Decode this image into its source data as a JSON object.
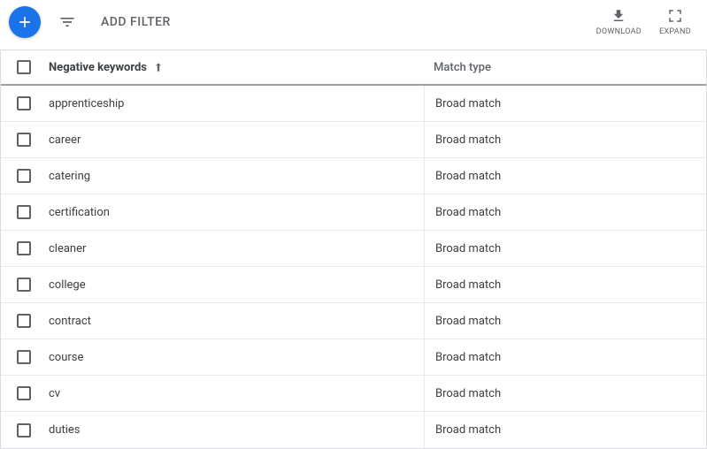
{
  "toolbar": {
    "add_filter_label": "ADD FILTER",
    "download_label": "DOWNLOAD",
    "expand_label": "EXPAND"
  },
  "table": {
    "header": {
      "keyword_col": "Negative keywords",
      "match_col": "Match type"
    },
    "rows": [
      {
        "keyword": "apprenticeship",
        "match": "Broad match"
      },
      {
        "keyword": "career",
        "match": "Broad match"
      },
      {
        "keyword": "catering",
        "match": "Broad match"
      },
      {
        "keyword": "certification",
        "match": "Broad match"
      },
      {
        "keyword": "cleaner",
        "match": "Broad match"
      },
      {
        "keyword": "college",
        "match": "Broad match"
      },
      {
        "keyword": "contract",
        "match": "Broad match"
      },
      {
        "keyword": "course",
        "match": "Broad match"
      },
      {
        "keyword": "cv",
        "match": "Broad match"
      },
      {
        "keyword": "duties",
        "match": "Broad match"
      }
    ]
  }
}
